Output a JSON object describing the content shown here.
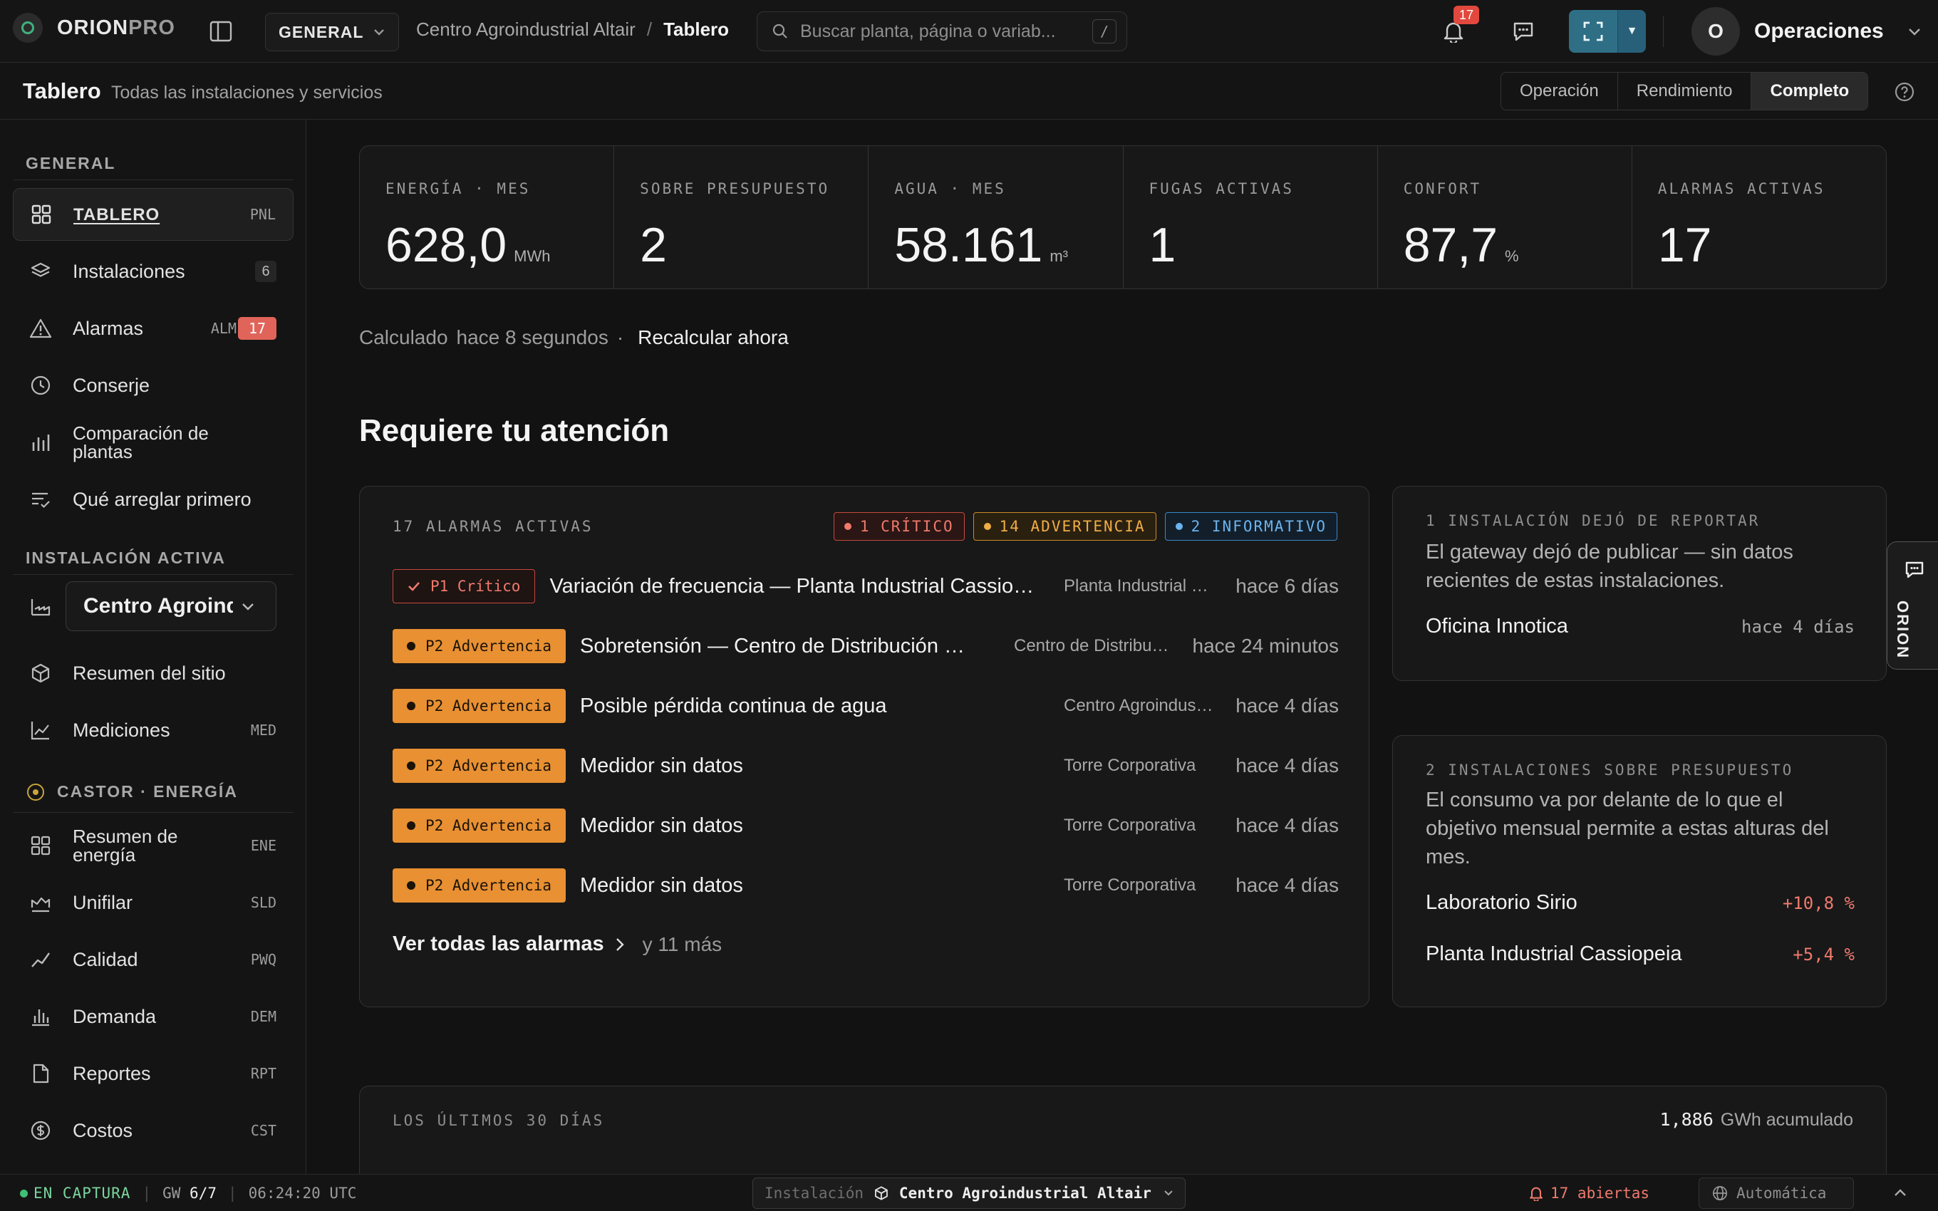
{
  "app": {
    "logo_main": "ORION",
    "logo_suffix": "PRO"
  },
  "topbar": {
    "workspace": "GENERAL",
    "breadcrumb": {
      "site": "Centro Agroindustrial Altair",
      "separator": "/",
      "current": "Tablero"
    },
    "search_placeholder": "Buscar planta, página o variab...",
    "search_shortcut": "/",
    "notifications_count": "17",
    "user_initial": "O",
    "user_name": "Operaciones"
  },
  "subheader": {
    "title": "Tablero",
    "subtitle": "Todas las instalaciones y servicios",
    "views": [
      "Operación",
      "Rendimiento",
      "Completo"
    ],
    "active_view": "Completo"
  },
  "sidebar": {
    "general_title": "GENERAL",
    "general_items": [
      {
        "label": "TABLERO",
        "code": "PNL",
        "icon": "grid-icon",
        "active": true
      },
      {
        "label": "Instalaciones",
        "count": "6",
        "icon": "layers-icon"
      },
      {
        "label": "Alarmas",
        "code": "ALM",
        "badge": "17",
        "icon": "warning-icon"
      },
      {
        "label": "Conserje",
        "icon": "clock-icon"
      },
      {
        "label": "Comparación de plantas",
        "label_line1": "Comparación de",
        "label_line2": "plantas",
        "icon": "bar-chart-icon"
      },
      {
        "label": "Qué arreglar primero",
        "icon": "checklist-icon"
      }
    ],
    "active_site_title": "INSTALACIÓN ACTIVA",
    "active_site_value": "Centro Agroindustrial Altair",
    "site_items": [
      {
        "label": "Resumen del sitio",
        "icon": "cube-icon"
      },
      {
        "label": "Mediciones",
        "code": "MED",
        "icon": "line-chart-icon"
      }
    ],
    "energy_title": "CASTOR · ENERGÍA",
    "energy_items": [
      {
        "label": "Resumen de energía",
        "label_line1": "Resumen de",
        "label_line2": "energía",
        "code": "ENE",
        "icon": "grid-icon"
      },
      {
        "label": "Unifilar",
        "code": "SLD",
        "icon": "single-line-icon"
      },
      {
        "label": "Calidad",
        "code": "PWQ",
        "icon": "trend-icon"
      },
      {
        "label": "Demanda",
        "code": "DEM",
        "icon": "demand-bars-icon"
      },
      {
        "label": "Reportes",
        "code": "RPT",
        "icon": "document-icon"
      },
      {
        "label": "Costos",
        "code": "CST",
        "icon": "currency-icon"
      }
    ]
  },
  "kpis": [
    {
      "label": "ENERGÍA · MES",
      "value": "628,0",
      "unit": "MWh"
    },
    {
      "label": "SOBRE PRESUPUESTO",
      "value": "2",
      "unit": ""
    },
    {
      "label": "AGUA · MES",
      "value": "58.161",
      "unit": "m³"
    },
    {
      "label": "FUGAS ACTIVAS",
      "value": "1",
      "unit": ""
    },
    {
      "label": "CONFORT",
      "value": "87,7",
      "unit": "%"
    },
    {
      "label": "ALARMAS ACTIVAS",
      "value": "17",
      "unit": ""
    }
  ],
  "calc": {
    "prefix": "Calculado",
    "age": "hace 8 segundos",
    "dot": "·",
    "action": "Recalcular ahora"
  },
  "attention": {
    "title": "Requiere tu atención",
    "alarms_header": "17 ALARMAS ACTIVAS",
    "pills": {
      "critical": "1 CRÍTICO",
      "warning": "14 ADVERTENCIA",
      "info": "2 INFORMATIVO"
    },
    "alarms": [
      {
        "severity": "P1 Crítico",
        "level": "p1",
        "title": "Variación de frecuencia — Planta Industrial Cassiopeia",
        "site": "Planta Industrial Cassiopeia",
        "time": "hace 6 días"
      },
      {
        "severity": "P2 Advertencia",
        "level": "p2",
        "title": "Sobretensión — Centro de Distribución Norte",
        "site": "Centro de Distribución Norte",
        "time": "hace 24 minutos"
      },
      {
        "severity": "P2 Advertencia",
        "level": "p2",
        "title": "Posible pérdida continua de agua",
        "site": "Centro Agroindustrial Altair",
        "time": "hace 4 días"
      },
      {
        "severity": "P2 Advertencia",
        "level": "p2",
        "title": "Medidor sin datos",
        "site": "Torre Corporativa",
        "time": "hace 4 días"
      },
      {
        "severity": "P2 Advertencia",
        "level": "p2",
        "title": "Medidor sin datos",
        "site": "Torre Corporativa",
        "time": "hace 4 días"
      },
      {
        "severity": "P2 Advertencia",
        "level": "p2",
        "title": "Medidor sin datos",
        "site": "Torre Corporativa",
        "time": "hace 4 días"
      }
    ],
    "see_all": "Ver todas las alarmas",
    "more": "y 11 más"
  },
  "stale_card": {
    "header": "1 INSTALACIÓN DEJÓ DE REPORTAR",
    "body": "El gateway dejó de publicar — sin datos recientes de estas instalaciones.",
    "rows": [
      {
        "name": "Oficina Innotica",
        "value": "hace 4 días"
      }
    ]
  },
  "budget_card": {
    "header": "2 INSTALACIONES SOBRE PRESUPUESTO",
    "body": "El consumo va por delante de lo que el objetivo mensual permite a estas alturas del mes.",
    "rows": [
      {
        "name": "Laboratorio Sirio",
        "value": "+10,8 %"
      },
      {
        "name": "Planta Industrial Cassiopeia",
        "value": "+5,4 %"
      }
    ]
  },
  "orion_tab": "ORION",
  "trend": {
    "header": "LOS ÚLTIMOS 30 DÍAS",
    "total": "1,886",
    "unit": "GWh acumulado"
  },
  "statusbar": {
    "live": "EN CAPTURA",
    "gw_label": "GW",
    "gw_value": "6/7",
    "time": "06:24:20 UTC",
    "install_label": "Instalación",
    "install_value": "Centro Agroindustrial Altair",
    "open_alarms": "17 abiertas",
    "mode": "Automática"
  },
  "colors": {
    "accent": "#2f6f86",
    "critical": "#f07a6c",
    "warning": "#e89032",
    "info": "#6bb3ee",
    "live": "#3fbf75"
  }
}
